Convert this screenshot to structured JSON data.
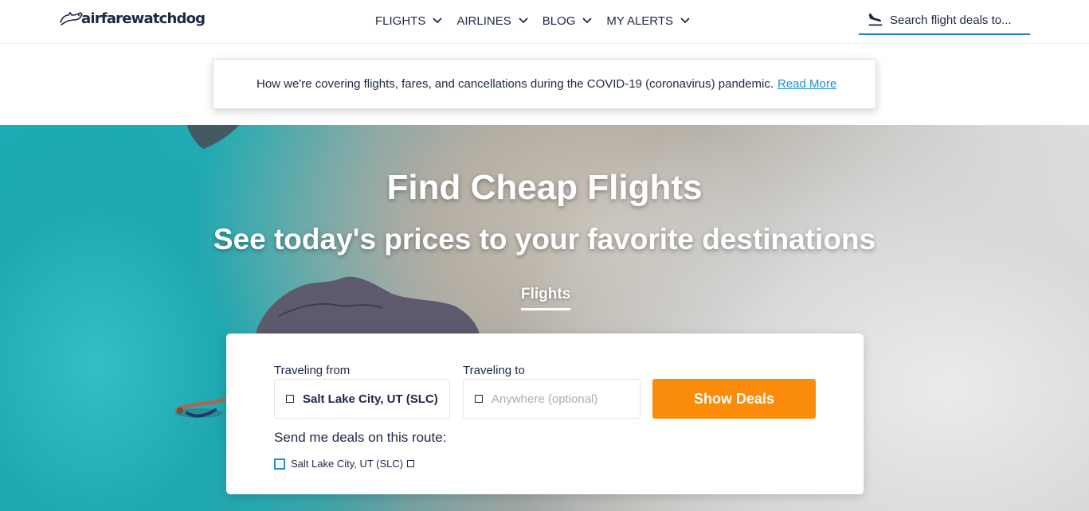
{
  "header": {
    "logo_text": "airfarewatchdog",
    "nav": [
      {
        "label": "FLIGHTS"
      },
      {
        "label": "AIRLINES"
      },
      {
        "label": "BLOG"
      },
      {
        "label": "MY ALERTS"
      }
    ],
    "search": {
      "placeholder": "Search flight deals to..."
    }
  },
  "notice": {
    "text": "How we're covering flights, fares, and cancellations during the COVID-19 (coronavirus) pandemic.",
    "link_label": "Read More"
  },
  "hero": {
    "title": "Find Cheap Flights",
    "subtitle": "See today's prices to your favorite destinations",
    "tab_label": "Flights"
  },
  "search_form": {
    "from_label": "Traveling from",
    "from_value": "Salt Lake City, UT (SLC)",
    "to_label": "Traveling to",
    "to_placeholder": "Anywhere (optional)",
    "submit_label": "Show Deals",
    "deals_label": "Send me deals on this route:",
    "route_label": "Salt Lake City, UT (SLC)"
  },
  "colors": {
    "accent": "#fa8c0a",
    "link": "#1b8fd6",
    "text": "#1d2746"
  },
  "icons": {
    "logo": "dog-logo-icon",
    "nav_chevron": "chevron-down-icon",
    "search": "plane-landing-icon"
  }
}
